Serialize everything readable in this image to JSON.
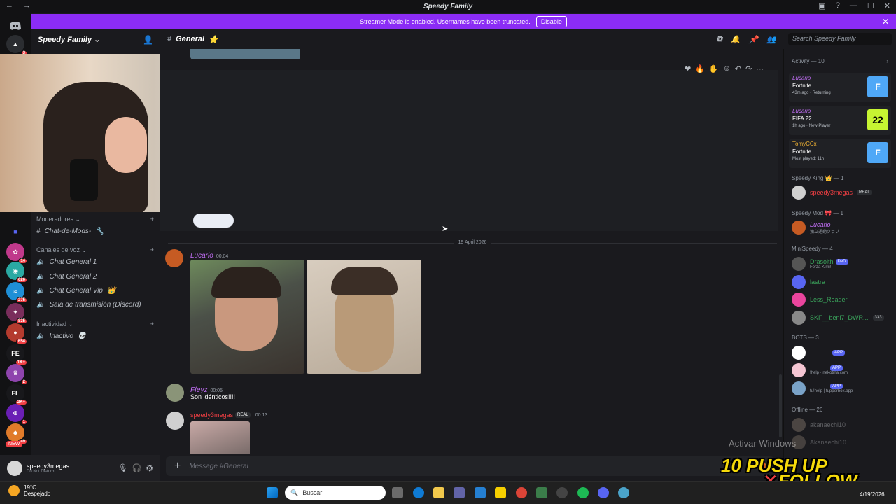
{
  "titlebar": {
    "title": "Speedy Family"
  },
  "banner": {
    "text": "Streamer Mode is enabled. Usernames have been truncated.",
    "disable": "Disable"
  },
  "server": {
    "name": "Speedy Family"
  },
  "channel": {
    "name": "General",
    "composer_placeholder": "Message #General"
  },
  "search": {
    "placeholder": "Search Speedy Family"
  },
  "rail": {
    "badges": [
      "3",
      "14",
      "626",
      "275",
      "835",
      "654",
      "1K+",
      "2",
      "2K+",
      "1",
      "49"
    ],
    "new_label": "NEW",
    "srv_labels": [
      "FE",
      "FL"
    ]
  },
  "sidebar": {
    "cat_mods": "Moderadores",
    "ch_mods": "Chat-de-Mods-",
    "cat_voice": "Canales de voz",
    "voice": [
      "Chat General 1",
      "Chat General 2",
      "Chat General Vip",
      "Sala de transmisión (Discord)"
    ],
    "cat_inactive": "Inactividad",
    "ch_inactive": "Inactivo"
  },
  "user": {
    "name": "speedy3megas",
    "status": "Do Not Disturb"
  },
  "messages": {
    "date": "19 April 2026",
    "m1": {
      "user": "Lucario",
      "time": "00:04"
    },
    "m2": {
      "user": "Ffeyz",
      "time": "00:05",
      "text": "Son idénticos!!!!"
    },
    "m3": {
      "user": "speedy3megas",
      "tag": "REAL",
      "time": "00:13"
    }
  },
  "members": {
    "activity_header": "Activity — 10",
    "activities": [
      {
        "name": "Lucario",
        "game": "Fortnite",
        "sub": "43m ago  ·  Returning",
        "icon": "F",
        "color": "#4fa8f7"
      },
      {
        "name": "Lucario",
        "game": "FIFA 22",
        "sub": "1h ago  ·  New Player",
        "icon": "22",
        "color": "#c6f432"
      },
      {
        "name": "TomyCCx",
        "game": "Fortnite",
        "sub": "Most played: 11h",
        "icon": "F",
        "color": "#4fa8f7"
      }
    ],
    "king_header": "Speedy King 👑 — 1",
    "king_name": "speedy3megas",
    "king_tag": "REAL",
    "mod_header": "Speedy Mod 🎀 — 1",
    "mod_name": "Lucario",
    "mod_sub": "独立運動クラブ",
    "mini_header": "MiniSpeedy — 4",
    "mini": [
      {
        "name": "Drasolth",
        "sub": "Forza Kimi!",
        "tag": "DeD",
        "color": "#3ba55c"
      },
      {
        "name": "lastra",
        "sub": "",
        "tag": "",
        "color": "#3ba55c"
      },
      {
        "name": "Less_Reader",
        "sub": "",
        "tag": "",
        "color": "#3ba55c"
      },
      {
        "name": "SKF__beni7_DWR...",
        "sub": "",
        "tag": "333",
        "color": "#3ba55c"
      }
    ],
    "bots_header": "BOTS — 3",
    "bots": [
      {
        "sub": "",
        "tag": "APP"
      },
      {
        "sub": "!help · nekotina.com",
        "tag": "APP"
      },
      {
        "sub": "tu!help | tupperbox.app",
        "tag": "APP"
      }
    ],
    "offline_header": "Offline — 26",
    "offline": [
      "akanaechi10",
      "Akanaechi10"
    ]
  },
  "taskbar": {
    "temp": "19°C",
    "weather": "Despejado",
    "search": "Buscar",
    "date": "4/19/2026"
  },
  "overlays": {
    "watermark": "Activar Windows",
    "promo_line1": "10 PUSH UP",
    "promo_line2": "FOLLOW"
  },
  "colors": {
    "accent": "#8b2cf5",
    "bg": "#1a1a1e",
    "online": "#3ba55c",
    "dnd": "#f23f43"
  }
}
